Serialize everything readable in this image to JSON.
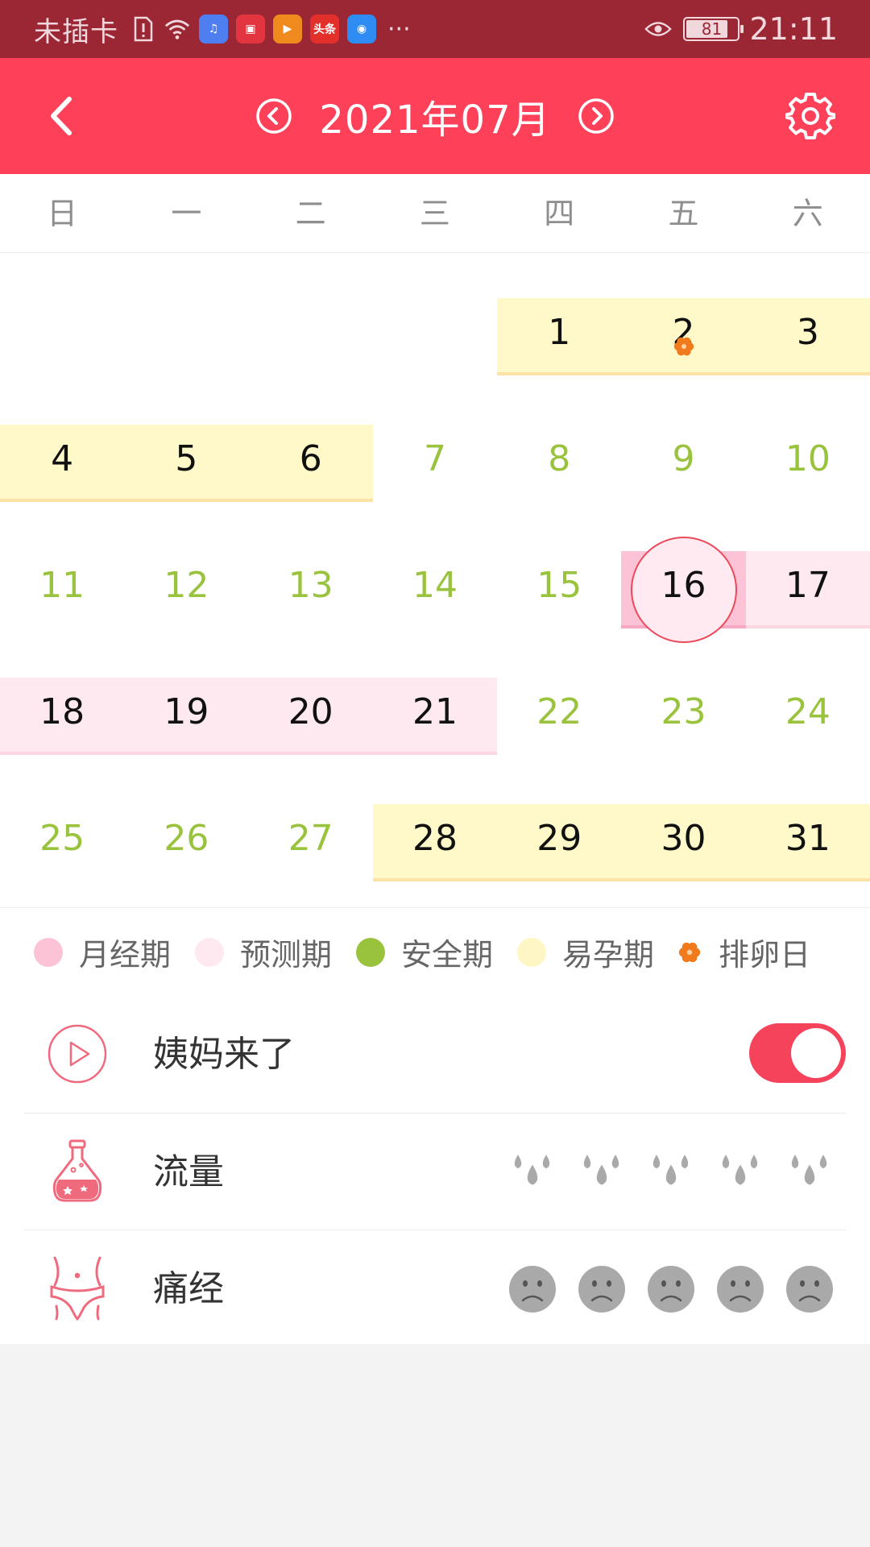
{
  "status_bar": {
    "carrier": "未插卡",
    "apps": [
      {
        "name": "music-app-icon",
        "color": "#4f7ef0",
        "glyph": "♫"
      },
      {
        "name": "book-app-icon",
        "color": "#e2353f",
        "glyph": "▣"
      },
      {
        "name": "video-app-icon",
        "color": "#f08a1f",
        "glyph": "▶"
      },
      {
        "name": "toutiao-app-icon",
        "color": "#e4302b",
        "glyph": "头条"
      },
      {
        "name": "browser-app-icon",
        "color": "#2f8cf2",
        "glyph": "◉"
      }
    ],
    "more": "···",
    "battery": "81",
    "time": "21:11"
  },
  "header": {
    "month_title": "2021年07月"
  },
  "calendar": {
    "weekdays": [
      "日",
      "一",
      "二",
      "三",
      "四",
      "五",
      "六"
    ],
    "first_weekday_index": 4,
    "days_in_month": 31,
    "today": 16,
    "ovulation_day": 2,
    "fertile_days": [
      1,
      2,
      3,
      4,
      5,
      6,
      28,
      29,
      30,
      31
    ],
    "period_days": [
      16
    ],
    "predicted_days": [
      17,
      18,
      19,
      20,
      21
    ],
    "safe_days": [
      7,
      8,
      9,
      10,
      11,
      12,
      13,
      14,
      15,
      22,
      23,
      24,
      25,
      26,
      27
    ]
  },
  "legend": [
    {
      "label": "月经期",
      "color": "#fcc2d6",
      "icon": "period-dot"
    },
    {
      "label": "预测期",
      "color": "#ffe9f0",
      "icon": "predicted-dot"
    },
    {
      "label": "安全期",
      "color": "#9ac33d",
      "icon": "safe-dot"
    },
    {
      "label": "易孕期",
      "color": "#fff6c6",
      "icon": "fertile-dot"
    },
    {
      "label": "排卵日",
      "color": "#f07a1c",
      "icon": "ovulation-icon"
    }
  ],
  "settings": {
    "period_came": {
      "label": "姨妈来了",
      "enabled": true
    },
    "flow": {
      "label": "流量",
      "levels": 5,
      "selected": 0
    },
    "cramps": {
      "label": "痛经",
      "levels": 5,
      "selected": 0
    }
  },
  "colors": {
    "status_bar": "#9b2634",
    "header": "#fe4059",
    "accent": "#f5435c",
    "safe_text": "#9ac33d",
    "inactive_level": "#a9a9a9"
  }
}
